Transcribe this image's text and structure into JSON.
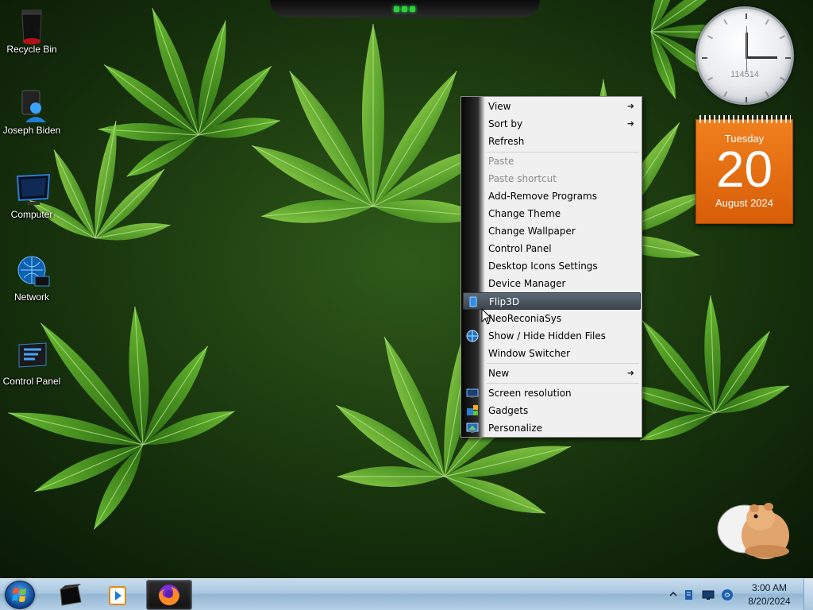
{
  "desktop": {
    "icons": [
      {
        "label": "Recycle Bin",
        "icon": "recycle-bin-icon"
      },
      {
        "label": "Joseph Biden",
        "icon": "user-folder-icon"
      },
      {
        "label": "Computer",
        "icon": "computer-icon"
      },
      {
        "label": "Network",
        "icon": "network-icon"
      },
      {
        "label": "Control Panel",
        "icon": "control-panel-icon"
      }
    ]
  },
  "gadgets": {
    "clock": {
      "digits": "114514"
    },
    "calendar": {
      "weekday": "Tuesday",
      "day": "20",
      "month_year": "August 2024",
      "color": "#e8700f"
    }
  },
  "context_menu": {
    "items": [
      {
        "label": "View",
        "submenu": true
      },
      {
        "label": "Sort by",
        "submenu": true
      },
      {
        "label": "Refresh"
      },
      {
        "label": "Paste",
        "disabled": true
      },
      {
        "label": "Paste shortcut",
        "disabled": true
      },
      {
        "label": "Add-Remove Programs"
      },
      {
        "label": "Change Theme"
      },
      {
        "label": "Change Wallpaper"
      },
      {
        "label": "Control Panel"
      },
      {
        "label": "Desktop Icons Settings"
      },
      {
        "label": "Device Manager"
      },
      {
        "label": "Flip3D",
        "highlighted": true,
        "icon": "flip3d-icon"
      },
      {
        "label": "NeoReconiaSys"
      },
      {
        "label": "Show / Hide Hidden Files",
        "icon": "globe-icon"
      },
      {
        "label": "Window Switcher"
      },
      {
        "label": "New",
        "submenu": true
      },
      {
        "label": "Screen resolution",
        "icon": "display-settings-icon"
      },
      {
        "label": "Gadgets",
        "icon": "gadgets-icon"
      },
      {
        "label": "Personalize",
        "icon": "personalize-icon"
      }
    ]
  },
  "taskbar": {
    "start": "start-orb-icon",
    "pinned": [
      "explorer-icon",
      "media-player-icon",
      "firefox-icon"
    ],
    "active_index": 2,
    "tray": {
      "time": "3:00 AM",
      "date": "8/20/2024"
    }
  }
}
